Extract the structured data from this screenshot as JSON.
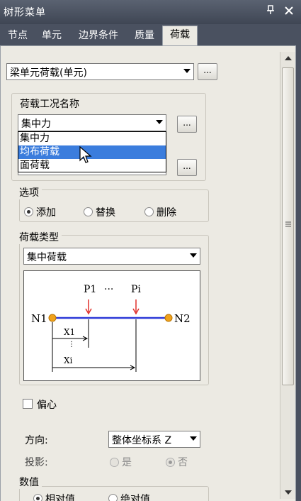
{
  "window": {
    "title": "树形菜单",
    "pin_icon": "pin-icon",
    "close_icon": "close-icon"
  },
  "tabs": [
    {
      "label": "节点",
      "active": false
    },
    {
      "label": "单元",
      "active": false
    },
    {
      "label": "边界条件",
      "active": false
    },
    {
      "label": "质量",
      "active": false
    },
    {
      "label": "荷载",
      "active": true
    }
  ],
  "load_type_combo": {
    "value": "梁单元荷载(单元)",
    "button_label": "..."
  },
  "load_case": {
    "label": "荷载工况名称",
    "value": "集中力",
    "button_label": "...",
    "dropdown_options": [
      "集中力",
      "均布荷载",
      "面荷载"
    ],
    "highlighted_index": 1,
    "second_button_label": "..."
  },
  "options": {
    "label": "选项",
    "radios": [
      {
        "label": "添加",
        "checked": true
      },
      {
        "label": "替换",
        "checked": false
      },
      {
        "label": "删除",
        "checked": false
      }
    ]
  },
  "load_category": {
    "label": "荷载类型",
    "value": "集中荷载"
  },
  "diagram": {
    "node_start": "N1",
    "node_end": "N2",
    "load1": "P1",
    "load_dots": "···",
    "load_i": "Pi",
    "dist1": "X1",
    "dist_i": "Xi",
    "beam_color": "#2d39d8",
    "load_color": "#e0302b",
    "node_color": "#f0a21c"
  },
  "eccentric": {
    "label": "偏心",
    "checked": false
  },
  "direction": {
    "label": "方向:",
    "value": "整体坐标系 Z"
  },
  "projection": {
    "label": "投影:",
    "radios": [
      {
        "label": "是",
        "checked": false
      },
      {
        "label": "否",
        "checked": true
      }
    ]
  },
  "values": {
    "label": "数值",
    "radios": [
      {
        "label": "相对值",
        "checked": true
      },
      {
        "label": "绝对值",
        "checked": false
      }
    ]
  }
}
